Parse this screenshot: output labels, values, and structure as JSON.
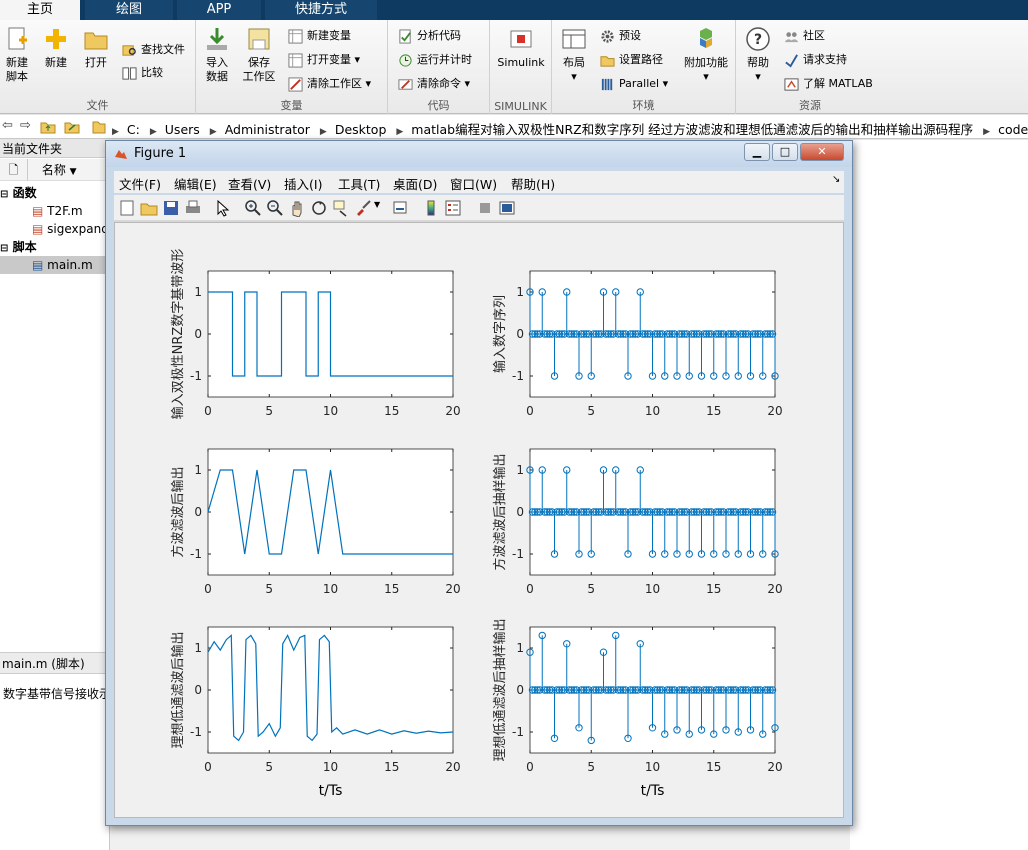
{
  "tabs": [
    {
      "label": "主页",
      "active": true
    },
    {
      "label": "绘图",
      "active": false
    },
    {
      "label": "APP",
      "active": false
    },
    {
      "label": "快捷方式",
      "active": false
    }
  ],
  "ribbon": {
    "file": {
      "group_label": "文件",
      "new_script": "新建\n脚本",
      "new": "新建",
      "open": "打开",
      "find_files": "查找文件",
      "compare": "比较"
    },
    "variable": {
      "group_label": "变量",
      "import": "导入\n数据",
      "save_ws": "保存\n工作区",
      "new_var": "新建变量",
      "open_var": "打开变量",
      "clear_ws": "清除工作区"
    },
    "code": {
      "group_label": "代码",
      "analyze": "分析代码",
      "run_time": "运行并计时",
      "clear_cmds": "清除命令"
    },
    "simulink": {
      "group_label": "SIMULINK",
      "simulink": "Simulink"
    },
    "env": {
      "group_label": "环境",
      "layout": "布局",
      "prefs": "预设",
      "set_path": "设置路径",
      "parallel": "Parallel",
      "addons": "附加功能"
    },
    "resources": {
      "group_label": "资源",
      "help": "帮助",
      "community": "社区",
      "request_support": "请求支持",
      "learn": "了解 MATLAB"
    }
  },
  "address": {
    "path": [
      "C:",
      "Users",
      "Administrator",
      "Desktop",
      "matlab编程对输入双极性NRZ和数字序列 经过方波滤波和理想低通滤波后的输出和抽样输出源码程序",
      "code"
    ]
  },
  "folder_pane": {
    "title": "当前文件夹",
    "col_name": "名称",
    "groups": [
      {
        "label": "函数",
        "files": [
          "T2F.m",
          "sigexpand.m"
        ]
      },
      {
        "label": "脚本",
        "files": [
          "main.m"
        ]
      }
    ],
    "details": "main.m  (脚本)",
    "description": "数字基带信号接收示意"
  },
  "figure": {
    "title": "Figure 1",
    "menu": [
      "文件(F)",
      "编辑(E)",
      "查看(V)",
      "插入(I)",
      "工具(T)",
      "桌面(D)",
      "窗口(W)",
      "帮助(H)"
    ],
    "xlabel": "t/Ts",
    "series_color": "#0072bd"
  },
  "chart_data": [
    {
      "type": "line",
      "ylabel": "输入双极性NRZ数字基带波形",
      "xlim": [
        0,
        20
      ],
      "ylim": [
        -1.5,
        1.5
      ],
      "xticks": [
        0,
        5,
        10,
        15,
        20
      ],
      "yticks": [
        -1,
        0,
        1
      ],
      "x": [
        0,
        2,
        2,
        3,
        3,
        4,
        4,
        6,
        6,
        8,
        8,
        9,
        9,
        10,
        10,
        20
      ],
      "y": [
        1,
        1,
        -1,
        -1,
        1,
        1,
        -1,
        -1,
        1,
        1,
        -1,
        -1,
        1,
        1,
        -1,
        -1
      ]
    },
    {
      "type": "stem",
      "ylabel": "输入数字序列",
      "xlim": [
        0,
        20
      ],
      "ylim": [
        -1.5,
        1.5
      ],
      "xticks": [
        0,
        5,
        10,
        15,
        20
      ],
      "yticks": [
        -1,
        0,
        1
      ],
      "x": [
        0,
        1,
        2,
        3,
        4,
        5,
        6,
        7,
        8,
        9,
        10,
        11,
        12,
        13,
        14,
        15,
        16,
        17,
        18,
        19,
        20
      ],
      "y": [
        1,
        1,
        -1,
        1,
        -1,
        -1,
        1,
        1,
        -1,
        1,
        -1,
        -1,
        -1,
        -1,
        -1,
        -1,
        -1,
        -1,
        -1,
        -1,
        -1
      ]
    },
    {
      "type": "line",
      "ylabel": "方波滤波后输出",
      "xlim": [
        0,
        20
      ],
      "ylim": [
        -1.5,
        1.5
      ],
      "xticks": [
        0,
        5,
        10,
        15,
        20
      ],
      "yticks": [
        -1,
        0,
        1
      ],
      "x": [
        0,
        1,
        2,
        3,
        4,
        5,
        6,
        7,
        8,
        9,
        10,
        11,
        20
      ],
      "y": [
        0,
        1,
        1,
        -1,
        1,
        -1,
        -1,
        1,
        1,
        -1,
        1,
        -1,
        -1
      ]
    },
    {
      "type": "stem",
      "ylabel": "方波滤波后抽样输出",
      "xlim": [
        0,
        20
      ],
      "ylim": [
        -1.5,
        1.5
      ],
      "xticks": [
        0,
        5,
        10,
        15,
        20
      ],
      "yticks": [
        -1,
        0,
        1
      ],
      "x": [
        0,
        1,
        2,
        3,
        4,
        5,
        6,
        7,
        8,
        9,
        10,
        11,
        12,
        13,
        14,
        15,
        16,
        17,
        18,
        19,
        20
      ],
      "y": [
        1,
        1,
        -1,
        1,
        -1,
        -1,
        1,
        1,
        -1,
        1,
        -1,
        -1,
        -1,
        -1,
        -1,
        -1,
        -1,
        -1,
        -1,
        -1,
        -1
      ]
    },
    {
      "type": "line",
      "ylabel": "理想低通滤波后输出",
      "xlim": [
        0,
        20
      ],
      "ylim": [
        -1.5,
        1.5
      ],
      "xticks": [
        0,
        5,
        10,
        15,
        20
      ],
      "yticks": [
        -1,
        0,
        1
      ],
      "x": [
        0,
        0.5,
        1.0,
        1.5,
        1.9,
        2.1,
        2.5,
        2.9,
        3.1,
        3.5,
        3.9,
        4.1,
        4.5,
        5.0,
        5.5,
        5.9,
        6.1,
        6.5,
        7.0,
        7.5,
        7.9,
        8.1,
        8.5,
        8.9,
        9.1,
        9.5,
        9.9,
        10.1,
        10.5,
        11.0,
        12.0,
        13.0,
        14.0,
        15.0,
        16.0,
        17.0,
        18.0,
        19.0,
        20.0
      ],
      "y": [
        0.9,
        1.15,
        0.95,
        1.2,
        1.3,
        -1.1,
        -1.2,
        -1.0,
        1.2,
        1.3,
        1.1,
        -1.1,
        -1.0,
        -0.8,
        -1.1,
        -0.9,
        1.1,
        1.3,
        0.95,
        1.25,
        1.3,
        -1.1,
        -1.2,
        -1.05,
        1.2,
        1.3,
        1.15,
        -1.0,
        -0.9,
        -1.05,
        -0.95,
        -1.05,
        -0.95,
        -1.05,
        -0.97,
        -1.03,
        -0.98,
        -1.02,
        -1.0
      ]
    },
    {
      "type": "stem",
      "ylabel": "理想低通滤波后抽样输出",
      "xlim": [
        0,
        20
      ],
      "ylim": [
        -1.5,
        1.5
      ],
      "xticks": [
        0,
        5,
        10,
        15,
        20
      ],
      "yticks": [
        -1,
        0,
        1
      ],
      "x": [
        0,
        1,
        2,
        3,
        4,
        5,
        6,
        7,
        8,
        9,
        10,
        11,
        12,
        13,
        14,
        15,
        16,
        17,
        18,
        19,
        20
      ],
      "y": [
        0.9,
        1.3,
        -1.15,
        1.1,
        -0.9,
        -1.2,
        0.9,
        1.3,
        -1.15,
        1.1,
        -0.9,
        -1.05,
        -0.95,
        -1.05,
        -0.95,
        -1.05,
        -0.95,
        -1.0,
        -0.95,
        -1.05,
        -0.9
      ]
    }
  ]
}
